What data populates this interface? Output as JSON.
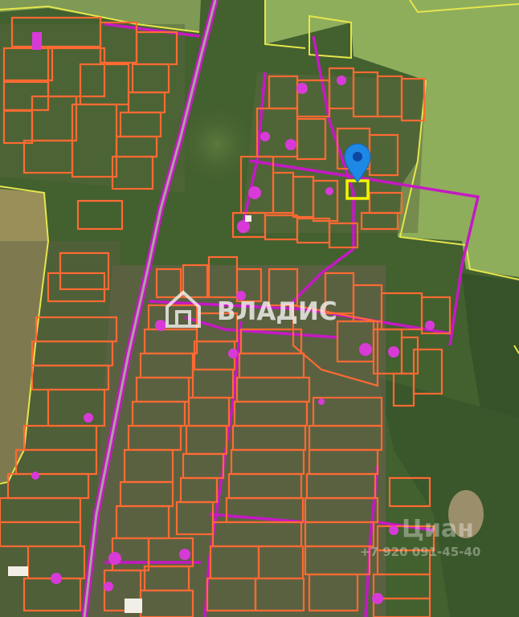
{
  "map": {
    "watermark_brand": "ВЛАДИС",
    "watermark_source": "Циан",
    "watermark_phone": "+7 920 091-45-40",
    "colors": {
      "parcel_border": "#ff6a33",
      "road_line": "#c419c4",
      "field_border": "#e6e64c",
      "selected_parcel": "#f4f400",
      "marker": "#1e88e5",
      "building": "#d83ad8"
    }
  }
}
